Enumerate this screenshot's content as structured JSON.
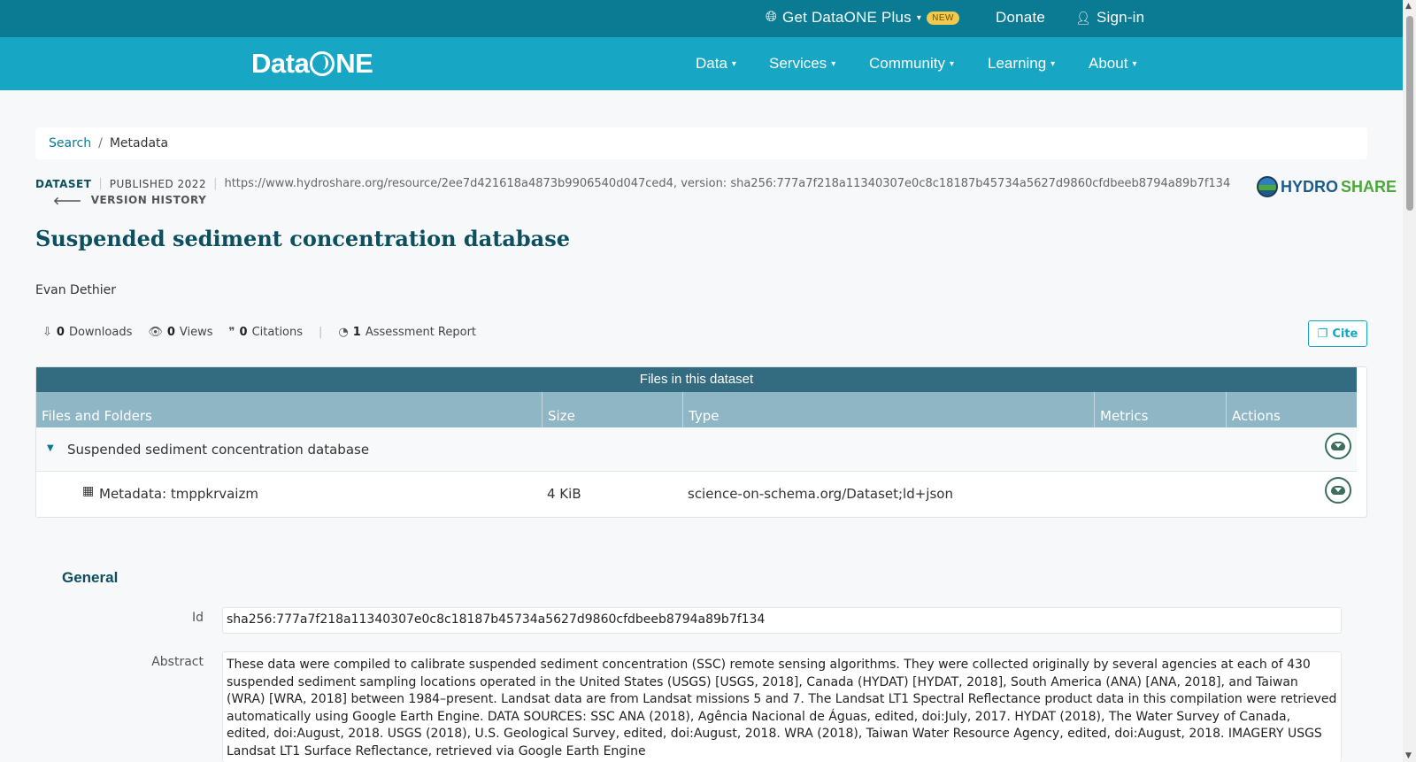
{
  "topbar": {
    "plus_label": "Get DataONE Plus",
    "new_badge": "NEW",
    "donate": "Donate",
    "signin": "Sign-in"
  },
  "nav": {
    "logo_left": "Data",
    "logo_right": "NE",
    "items": [
      "Data",
      "Services",
      "Community",
      "Learning",
      "About"
    ]
  },
  "breadcrumb": {
    "search": "Search",
    "sep": "/",
    "current": "Metadata"
  },
  "meta": {
    "type": "DATASET",
    "published": "PUBLISHED 2022",
    "url": "https://www.hydroshare.org/resource/2ee7d421618a4873b9906540d047ced4, version: sha256:777a7f218a11340307e0c8c18187b45734a5627d9860cfdbeeb8794a89b7f134",
    "version_history": "VERSION HISTORY",
    "repo_part1": "HYDRO",
    "repo_part2": "SHARE"
  },
  "title": "Suspended sediment concentration database",
  "author": "Evan Dethier",
  "metrics": {
    "downloads_count": "0",
    "downloads_label": "Downloads",
    "views_count": "0",
    "views_label": "Views",
    "citations_count": "0",
    "citations_label": "Citations",
    "report_count": "1",
    "report_label": "Assessment Report",
    "cite": "Cite"
  },
  "files": {
    "header": "Files in this dataset",
    "columns": [
      "Files and Folders",
      "Size",
      "Type",
      "Metrics",
      "Actions"
    ],
    "folder": "Suspended sediment concentration database",
    "file_name": "Metadata: tmppkrvaizm",
    "file_size": "4 KiB",
    "file_type": "science-on-schema.org/Dataset;ld+json"
  },
  "general": {
    "title": "General",
    "id_label": "Id",
    "id_value": "sha256:777a7f218a11340307e0c8c18187b45734a5627d9860cfdbeeb8794a89b7f134",
    "abstract_label": "Abstract",
    "abstract_value": "These data were compiled to calibrate suspended sediment concentration (SSC) remote sensing algorithms. They were collected originally by several agencies at each of 430 suspended sediment sampling locations operated in the United States (USGS) [USGS, 2018], Canada (HYDAT) [HYDAT, 2018], South America (ANA) [ANA, 2018], and Taiwan (WRA) [WRA, 2018] between 1984–present. Landsat data are from Landsat missions 5 and 7. The Landsat LT1 Spectral Reflectance product data in this compilation were retrieved automatically using Google Earth Engine. DATA SOURCES: SSC ANA (2018), Agência Nacional de Águas, edited, doi:July, 2017. HYDAT (2018), The Water Survey of Canada, edited, doi:August, 2018. USGS (2018), U.S. Geological Survey, edited, doi:August, 2018. WRA (2018), Taiwan Water Resource Agency, edited, doi:August, 2018. IMAGERY USGS Landsat LT1 Surface Reflectance, retrieved via Google Earth Engine"
  }
}
